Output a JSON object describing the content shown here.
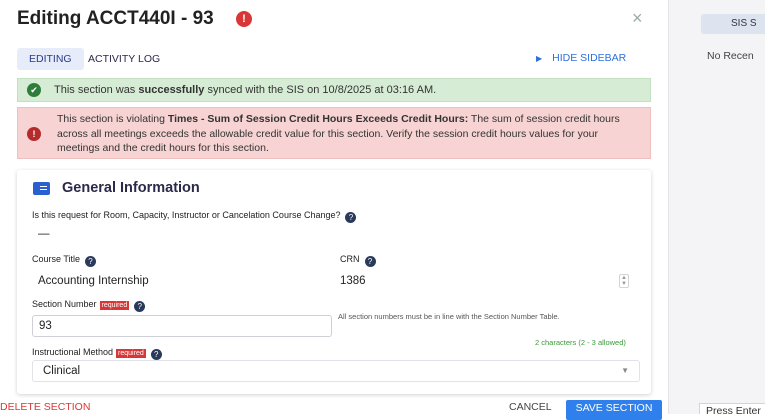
{
  "header": {
    "title": "Editing ACCT440I - 93",
    "alert_icon": "!",
    "close_icon": "×"
  },
  "tabs": {
    "editing": "EDITING",
    "activity_log": "ACTIVITY LOG",
    "hide_sidebar": "HIDE SIDEBAR"
  },
  "alerts": {
    "success_prefix": "This section was ",
    "success_bold": "successfully",
    "success_suffix": " synced with the SIS on 10/8/2025 at 03:16 AM.",
    "error_prefix": "This section is violating ",
    "error_bold": "Times - Sum of Session Credit Hours Exceeds Credit Hours:",
    "error_suffix": " The sum of session credit hours across all meetings exceeds the allowable credit value for this section. Verify the session credit hours values for your meetings and the credit hours for this section."
  },
  "general": {
    "title": "General Information",
    "change_request_label": "Is this request for Room, Capacity, Instructor or Cancelation Course Change?",
    "change_request_value": "—",
    "course_title_label": "Course Title",
    "course_title_value": "Accounting Internship",
    "crn_label": "CRN",
    "crn_value": "1386",
    "section_number_label": "Section Number",
    "required_badge": "required",
    "section_number_value": "93",
    "section_number_note": "All section numbers must be in line with the Section Number Table.",
    "section_number_count": "2 characters (2 - 3 allowed)",
    "instructional_method_label": "Instructional Method",
    "instructional_method_value": "Clinical"
  },
  "footer": {
    "delete": "DELETE SECTION",
    "cancel": "CANCEL",
    "save": "SAVE SECTION"
  },
  "sidebar": {
    "tab": "SIS S",
    "no_recent": "No Recen",
    "press_enter": "Press Enter"
  },
  "colors": {
    "accent": "#2f80ed",
    "danger": "#d93737",
    "success_bg": "#d6ecd4",
    "error_bg": "#f7d3d3",
    "count_green": "#3a9a3a"
  }
}
